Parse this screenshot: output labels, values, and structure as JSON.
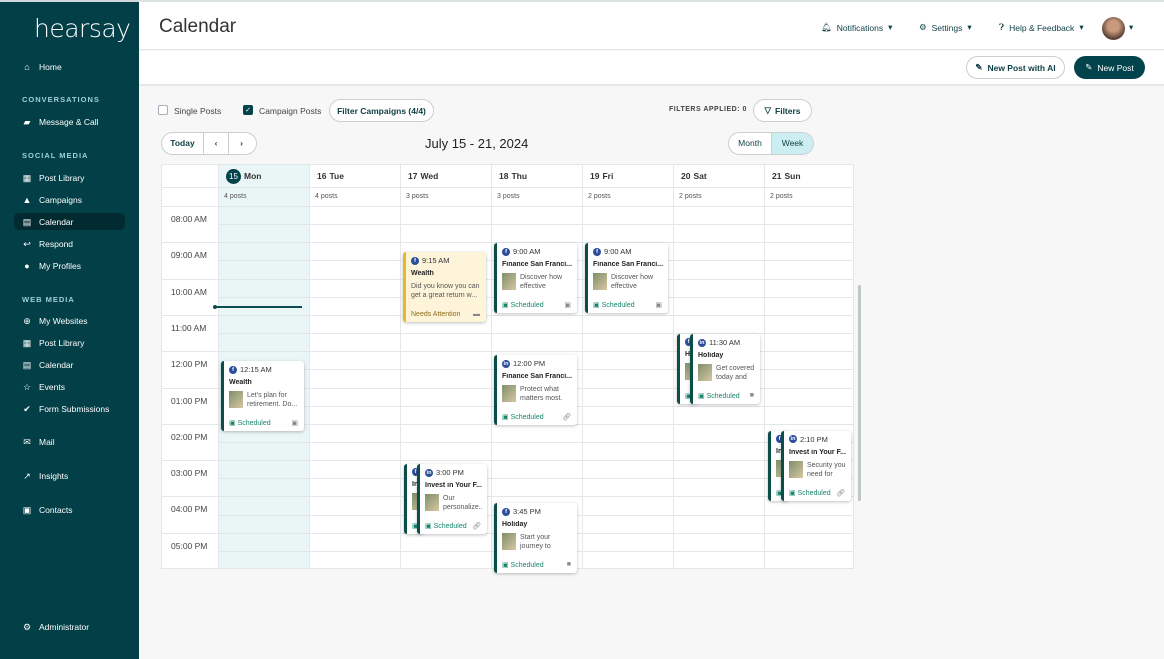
{
  "sidebar": {
    "logo": "hearsay",
    "sections": [
      {
        "type": "item",
        "label": "Home",
        "icon": "home-icon",
        "glyph": "⌂"
      },
      {
        "type": "section",
        "label": "CONVERSATIONS"
      },
      {
        "type": "item",
        "label": "Message & Call",
        "icon": "chat-icon",
        "glyph": "▰"
      },
      {
        "type": "section",
        "label": "SOCIAL MEDIA"
      },
      {
        "type": "item",
        "label": "Post Library",
        "icon": "library-icon",
        "glyph": "▦"
      },
      {
        "type": "item",
        "label": "Campaigns",
        "icon": "thumbs-up-icon",
        "glyph": "▲"
      },
      {
        "type": "item",
        "label": "Calendar",
        "icon": "calendar-icon",
        "glyph": "▤",
        "active": true
      },
      {
        "type": "item",
        "label": "Respond",
        "icon": "reply-icon",
        "glyph": "↩"
      },
      {
        "type": "item",
        "label": "My Profiles",
        "icon": "profile-icon",
        "glyph": "●"
      },
      {
        "type": "section",
        "label": "WEB MEDIA"
      },
      {
        "type": "item",
        "label": "My Websites",
        "icon": "globe-icon",
        "glyph": "⊕"
      },
      {
        "type": "item",
        "label": "Post Library",
        "icon": "library-icon",
        "glyph": "▦"
      },
      {
        "type": "item",
        "label": "Calendar",
        "icon": "calendar-icon",
        "glyph": "▤"
      },
      {
        "type": "item",
        "label": "Events",
        "icon": "events-icon",
        "glyph": "☆"
      },
      {
        "type": "item",
        "label": "Form Submissions",
        "icon": "check-circle-icon",
        "glyph": "✔"
      },
      {
        "type": "item",
        "label": "Mail",
        "icon": "mail-icon",
        "glyph": "✉"
      },
      {
        "type": "item",
        "label": "Insights",
        "icon": "trend-icon",
        "glyph": "↗"
      },
      {
        "type": "item",
        "label": "Contacts",
        "icon": "contact-icon",
        "glyph": "▣"
      },
      {
        "type": "item",
        "label": "Administrator",
        "icon": "admin-gear-icon",
        "glyph": "⚙"
      }
    ]
  },
  "header": {
    "title": "Calendar",
    "notifications": "Notifications",
    "settings": "Settings",
    "help": "Help & Feedback"
  },
  "actions": {
    "new_post_ai": "New Post with AI",
    "new_post": "New Post"
  },
  "filters": {
    "single_posts": "Single Posts",
    "single_checked": false,
    "campaign_posts": "Campaign Posts",
    "campaign_checked": true,
    "filter_campaigns": "Filter Campaigns (4/4)",
    "applied": "FILTERS APPLIED: 0",
    "filters_button": "Filters"
  },
  "nav": {
    "today": "Today",
    "range": "July 15 - 21, 2024",
    "month": "Month",
    "week": "Week",
    "active_view": "Week"
  },
  "days": [
    {
      "num": "15",
      "name": "Mon",
      "posts": "4 posts",
      "today": true
    },
    {
      "num": "16",
      "name": "Tue",
      "posts": "4 posts"
    },
    {
      "num": "17",
      "name": "Wed",
      "posts": "3 posts"
    },
    {
      "num": "18",
      "name": "Thu",
      "posts": "3 posts"
    },
    {
      "num": "19",
      "name": "Fri",
      "posts": "2 posts"
    },
    {
      "num": "20",
      "name": "Sat",
      "posts": "2 posts"
    },
    {
      "num": "21",
      "name": "Sun",
      "posts": "2 posts"
    }
  ],
  "hours": [
    "08:00 AM",
    "09:00 AM",
    "10:00 AM",
    "11:00 AM",
    "12:00 PM",
    "01:00 PM",
    "02:00 PM",
    "03:00 PM",
    "04:00 PM",
    "05:00 PM"
  ],
  "events": [
    {
      "day": 2,
      "hour": 9.15,
      "time": "9:15 AM",
      "network": "facebook",
      "title": "Wealth",
      "text": "Did you know you can get a great return w...",
      "status": "Needs Attention",
      "media": "comment",
      "warn": true
    },
    {
      "day": 3,
      "hour": 9.0,
      "time": "9:00 AM",
      "network": "facebook",
      "title": "Finance San Franci...",
      "text": "Discover how effective budge...",
      "status": "Scheduled",
      "media": "image"
    },
    {
      "day": 4,
      "hour": 9.0,
      "time": "9:00 AM",
      "network": "facebook",
      "title": "Finance San Franci...",
      "text": "Discover how effective budge...",
      "status": "Scheduled",
      "media": "image"
    },
    {
      "day": 5,
      "hour": 11.3,
      "time": "11:30 AM",
      "network": "facebook",
      "title": "Holiday",
      "text": "",
      "status": "",
      "media": "",
      "back": true
    },
    {
      "day": 5,
      "hour": 11.3,
      "time": "11:30 AM",
      "network": "linkedin",
      "title": "Holiday",
      "text": "Get covered today and li...",
      "status": "Scheduled",
      "media": "video",
      "front": true
    },
    {
      "day": 3,
      "hour": 12.05,
      "time": "12:00 PM",
      "network": "linkedin",
      "title": "Finance San Franci...",
      "text": "Protect what matters most. L...",
      "status": "Scheduled",
      "media": "link"
    },
    {
      "day": 0,
      "hour": 12.15,
      "time": "12:15 AM",
      "network": "facebook",
      "title": "Wealth",
      "text": "Let's plan for retirement. Do...",
      "status": "Scheduled",
      "media": "image"
    },
    {
      "day": 6,
      "hour": 14.1,
      "time": "2:10 PM",
      "network": "facebook",
      "title": "Invest in Your F...",
      "text": "",
      "status": "",
      "media": "",
      "back": true
    },
    {
      "day": 6,
      "hour": 14.1,
      "time": "2:10 PM",
      "network": "linkedin",
      "title": "Invest in Your F...",
      "text": "Security you need for life...",
      "status": "Scheduled",
      "media": "link",
      "front": true
    },
    {
      "day": 2,
      "hour": 15.05,
      "time": "3:00 PM",
      "network": "facebook",
      "title": "Invest in Your F...",
      "text": "",
      "status": "",
      "media": "",
      "back": true
    },
    {
      "day": 2,
      "hour": 15.05,
      "time": "3:00 PM",
      "network": "linkedin",
      "title": "Invest in Your F...",
      "text": "Our personalize...",
      "status": "Scheduled",
      "media": "link",
      "front": true
    },
    {
      "day": 3,
      "hour": 15.7,
      "time": "3:45 PM",
      "network": "facebook",
      "title": "Holiday",
      "text": "Start your journey to financial succ...",
      "status": "Scheduled",
      "media": "video"
    }
  ],
  "colors": {
    "sidebar": "#033f47",
    "accent": "#03434b",
    "scheduled": "#17856b",
    "warning": "#e8b923",
    "facebook": "#2b4e9b"
  }
}
